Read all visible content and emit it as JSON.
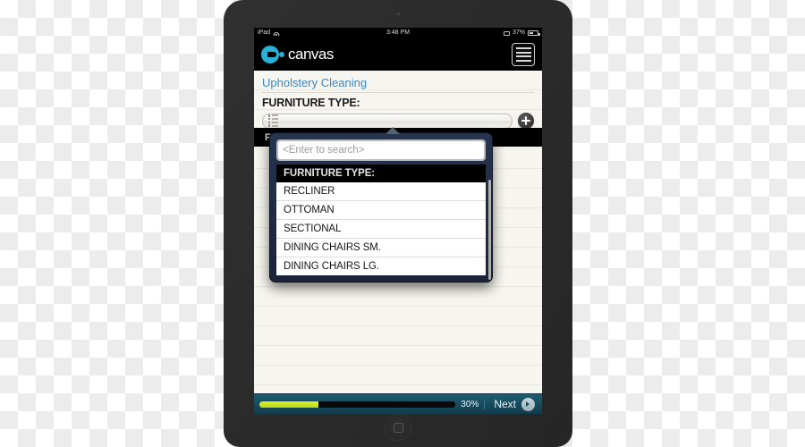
{
  "status_bar": {
    "carrier": "iPad",
    "wifi_icon": "wifi-icon",
    "time": "3:48 PM",
    "lock_icon": "rotation-lock-icon",
    "battery_percent": "37%",
    "battery_icon": "battery-icon"
  },
  "header": {
    "brand_name": "canvas",
    "brand_icon": "canvas-logo-icon",
    "menu_icon": "hamburger-menu-icon"
  },
  "form": {
    "title": "Upholstery Cleaning",
    "field_label": "FURNITURE TYPE:",
    "select_value": "",
    "select_icon": "list-select-icon",
    "add_icon": "plus-circle-icon",
    "selected_band_label": "FURNITURE TYPE:"
  },
  "popover": {
    "search_placeholder": "<Enter to search>",
    "search_value": "",
    "list_header": "FURNITURE TYPE:",
    "items": [
      "RECLINER",
      "OTTOMAN",
      "SECTIONAL",
      "DINING CHAIRS SM.",
      "DINING CHAIRS LG."
    ]
  },
  "bottom_bar": {
    "progress_percent": 30,
    "progress_label": "30%",
    "next_label": "Next",
    "next_icon": "arrow-right-circle-icon"
  },
  "colors": {
    "brand_cyan": "#2ab0d6",
    "title_blue": "#3d87bd",
    "progress_green": "#c9e318",
    "bottom_bar_teal": "#184b5f",
    "popover_navy": "#26344f"
  }
}
